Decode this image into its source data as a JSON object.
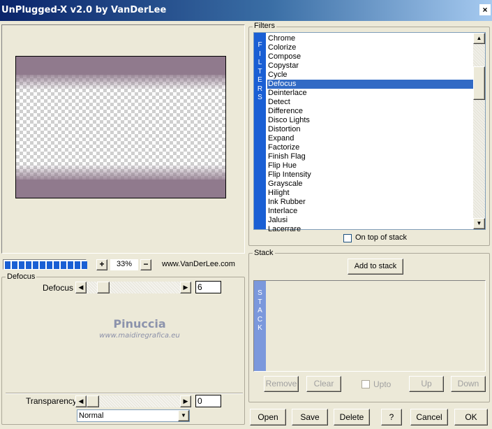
{
  "window": {
    "title": "UnPlugged-X v2.0 by VanDerLee",
    "close_symbol": "×"
  },
  "preview": {
    "zoom": "33%",
    "zoom_in": "+",
    "zoom_out": "−",
    "website": "www.VanDerLee.com",
    "progress_segments": 12
  },
  "defocus_group": {
    "label": "Defocus",
    "param_label": "Defocus",
    "param_value": "6",
    "watermark_name": "Pinuccia",
    "watermark_url": "www.maidiregrafica.eu"
  },
  "transparency": {
    "label": "Transparency",
    "value": "0",
    "blend_mode": "Normal"
  },
  "filters": {
    "group_label": "Filters",
    "side_label": [
      "F",
      "I",
      "L",
      "T",
      "E",
      "R",
      "S"
    ],
    "items": [
      "Chrome",
      "Colorize",
      "Compose",
      "Copystar",
      "Cycle",
      "Defocus",
      "Deinterlace",
      "Detect",
      "Difference",
      "Disco Lights",
      "Distortion",
      "Expand",
      "Factorize",
      "Finish Flag",
      "Flip Hue",
      "Flip Intensity",
      "Grayscale",
      "Hilight",
      "Ink Rubber",
      "Interlace",
      "Jalusi",
      "Lacerrare"
    ],
    "selected": "Defocus",
    "on_top_label": "On top of stack"
  },
  "stack": {
    "group_label": "Stack",
    "add_button": "Add to stack",
    "side_label": [
      "S",
      "T",
      "A",
      "C",
      "K"
    ],
    "remove_button": "Remove",
    "clear_button": "Clear",
    "upto_label": "Upto",
    "up_button": "Up",
    "down_button": "Down"
  },
  "buttons": {
    "open": "Open",
    "save": "Save",
    "delete": "Delete",
    "help": "?",
    "cancel": "Cancel",
    "ok": "OK"
  },
  "icons": {
    "scroll_up": "▲",
    "scroll_down": "▼",
    "arrow_left": "◀",
    "arrow_right": "▶",
    "dropdown": "▼"
  },
  "colors": {
    "accent": "#1a5fd4",
    "selection": "#316ac5",
    "preview_bg": "#907a8d"
  }
}
